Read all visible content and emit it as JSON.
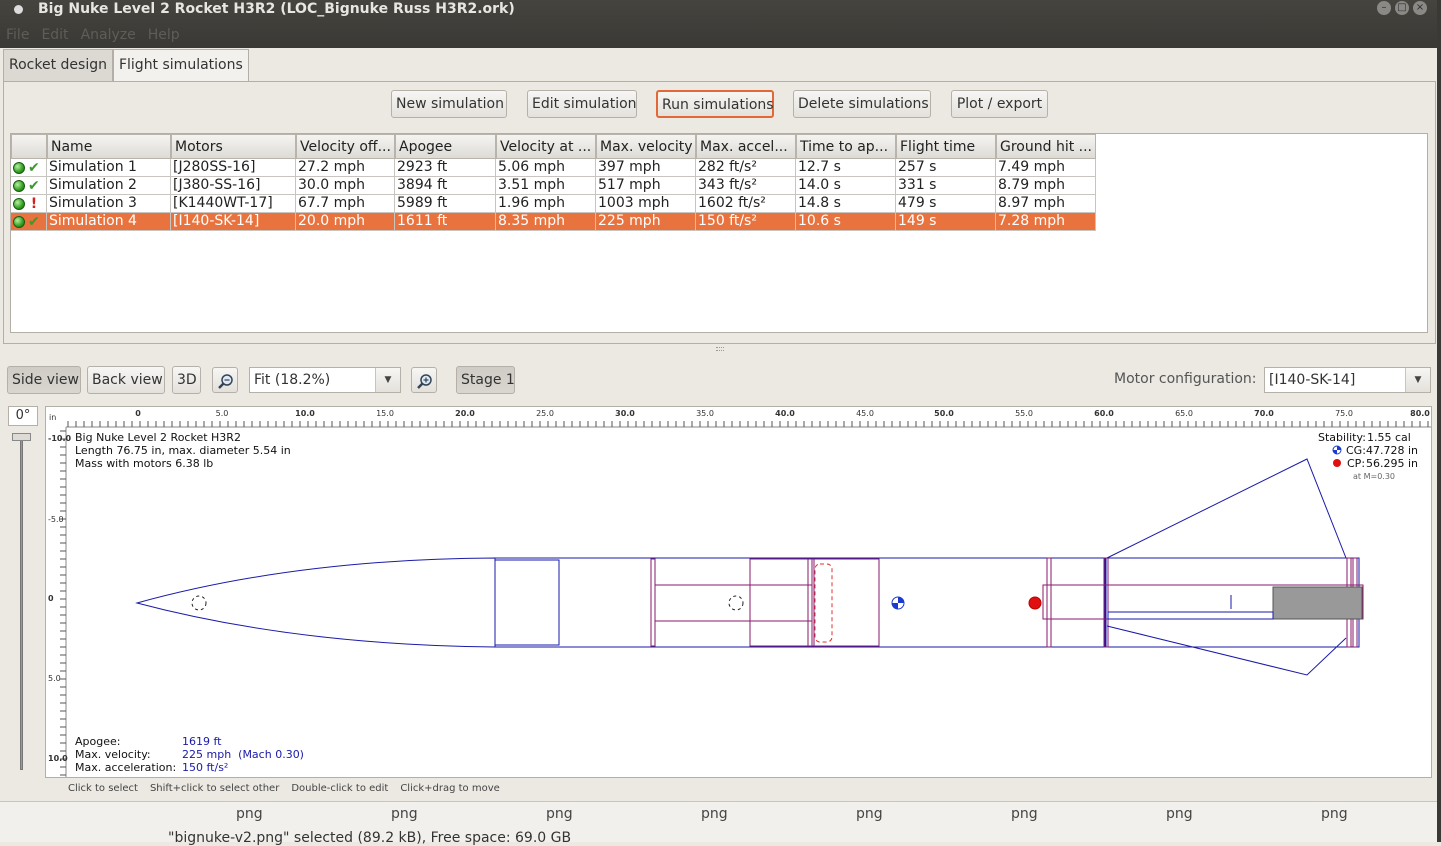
{
  "window": {
    "title": "Big Nuke Level 2 Rocket H3R2 (LOC_Bignuke Russ H3R2.ork)",
    "controls": [
      "–",
      "□",
      "×"
    ]
  },
  "menu": [
    "File",
    "Edit",
    "Analyze",
    "Help"
  ],
  "tabs": [
    {
      "label": "Rocket design",
      "active": false
    },
    {
      "label": "Flight simulations",
      "active": true
    }
  ],
  "toolbar": {
    "new_sim": "New simulation",
    "edit_sim": "Edit simulation",
    "run_sims": "Run simulations",
    "delete_sims": "Delete simulations",
    "plot_export": "Plot / export"
  },
  "table": {
    "headers": [
      "",
      "Name",
      "Motors",
      "Velocity off...",
      "Apogee",
      "Velocity at ...",
      "Max. velocity",
      "Max. accel...",
      "Time to ap...",
      "Flight time",
      "Ground hit ..."
    ],
    "rows": [
      {
        "status": "ok",
        "cells": [
          "Simulation 1",
          "[J280SS-16]",
          "27.2 mph",
          "2923 ft",
          "5.06 mph",
          "397 mph",
          "282 ft/s²",
          "12.7 s",
          "257 s",
          "7.49 mph"
        ]
      },
      {
        "status": "ok",
        "cells": [
          "Simulation 2",
          "[J380-SS-16]",
          "30.0 mph",
          "3894 ft",
          "3.51 mph",
          "517 mph",
          "343 ft/s²",
          "14.0 s",
          "331 s",
          "8.79 mph"
        ]
      },
      {
        "status": "warning",
        "cells": [
          "Simulation 3",
          "[K1440WT-17]",
          "67.7 mph",
          "5989 ft",
          "1.96 mph",
          "1003 mph",
          "1602 ft/s²",
          "14.8 s",
          "479 s",
          "8.97 mph"
        ]
      },
      {
        "status": "ok",
        "selected": true,
        "cells": [
          "Simulation 4",
          "[I140-SK-14]",
          "20.0 mph",
          "1611 ft",
          "8.35 mph",
          "225 mph",
          "150 ft/s²",
          "10.6 s",
          "149 s",
          "7.28 mph"
        ]
      }
    ]
  },
  "view": {
    "side_view": "Side view",
    "back_view": "Back view",
    "three_d": "3D",
    "zoom_value": "Fit (18.2%)",
    "stage": "Stage 1",
    "motor_config_label": "Motor configuration:",
    "motor_config_value": "[I140-SK-14]",
    "angle": "0°"
  },
  "ruler": {
    "unit": "in",
    "h_labels": [
      "0",
      "5.0",
      "10.0",
      "15.0",
      "20.0",
      "25.0",
      "30.0",
      "35.0",
      "40.0",
      "45.0",
      "50.0",
      "55.0",
      "60.0",
      "65.0",
      "70.0",
      "75.0",
      "80.0"
    ],
    "v_labels": [
      "-10.0",
      "-5.0",
      "0",
      "5.0",
      "10.0"
    ]
  },
  "rocket_info": {
    "name": "Big Nuke Level 2 Rocket H3R2",
    "length_line": "Length 76.75 in, max. diameter 5.54 in",
    "mass_line": "Mass with motors 6.38 lb",
    "stability_label": "Stability:",
    "stability_value": "1.55 cal",
    "cg_label": "CG:",
    "cg_value": "47.728 in",
    "cp_label": "CP:",
    "cp_value": "56.295 in",
    "mach_note": "at M=0.30"
  },
  "flight_info": {
    "apogee_label": "Apogee:",
    "apogee_value": "1619 ft",
    "maxv_label": "Max. velocity:",
    "maxv_value": "225 mph  (Mach 0.30)",
    "maxa_label": "Max. acceleration:",
    "maxa_value": "150 ft/s²"
  },
  "hints": [
    "Click to select",
    "Shift+click to select other",
    "Double-click to edit",
    "Click+drag to move"
  ],
  "file_strip": {
    "labels": [
      "png",
      "png",
      "png",
      "png",
      "png",
      "png",
      "png",
      "png"
    ],
    "status": "\"bignuke-v2.png\" selected (89.2 kB), Free space: 69.0 GB"
  },
  "colors": {
    "selection": "#e8733f",
    "rocket_outline": "#1a1aa8",
    "internal_outline": "#8a1a6a",
    "cp_marker": "#e01010",
    "cg_marker": "#1a3ad0"
  }
}
